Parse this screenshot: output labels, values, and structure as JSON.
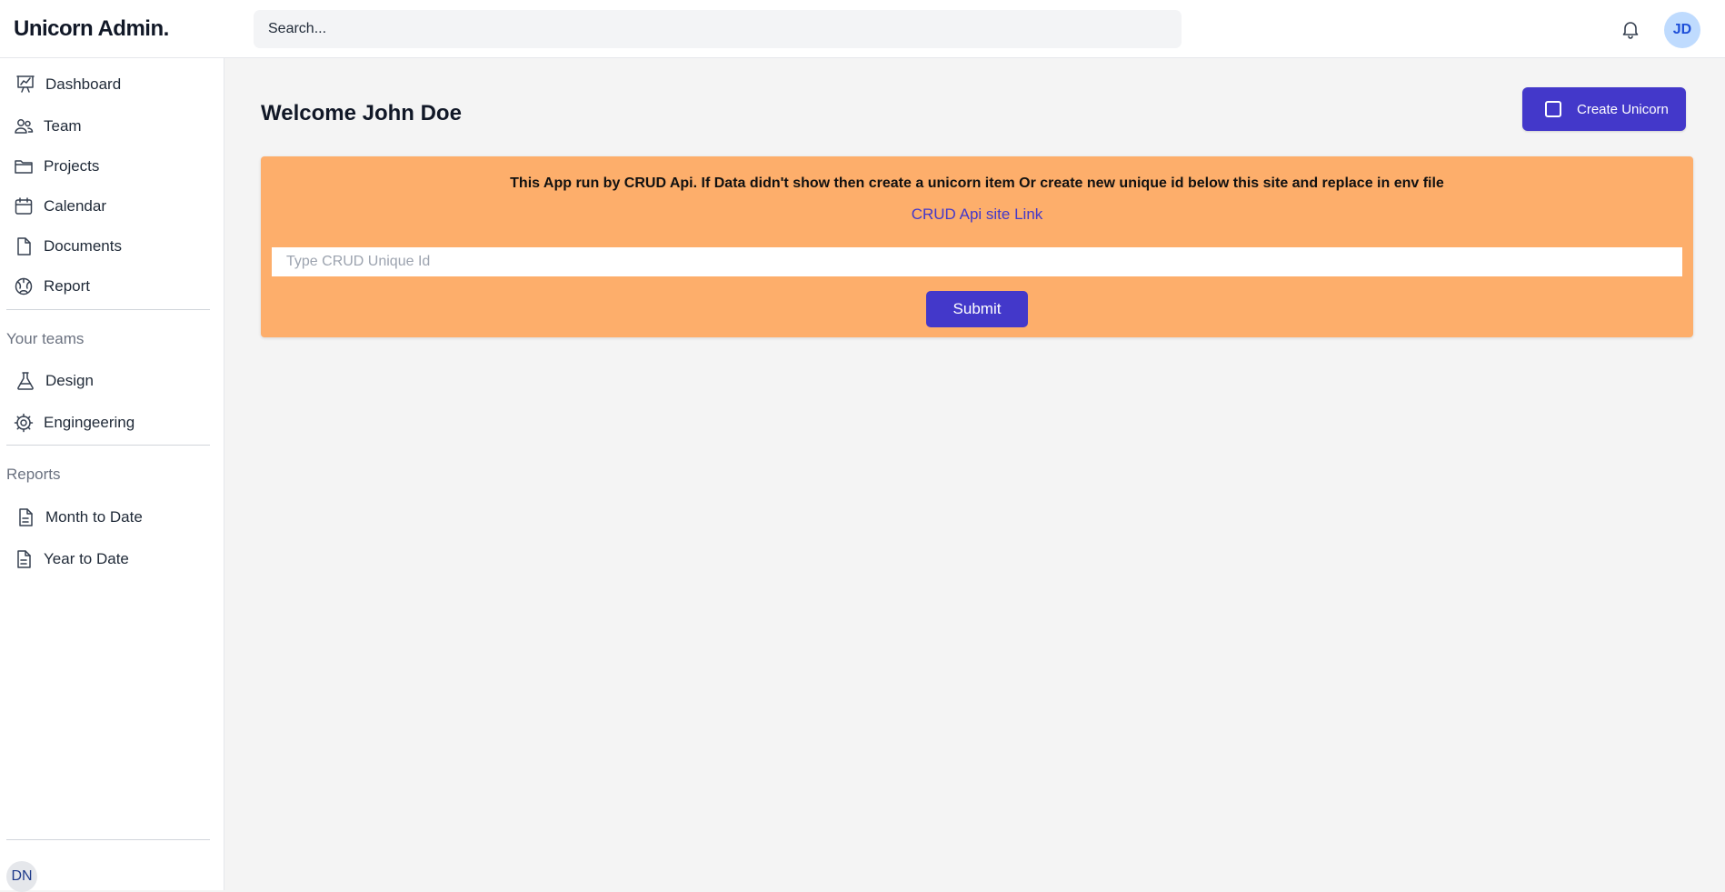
{
  "app": {
    "brand": "Unicorn Admin."
  },
  "header": {
    "search_placeholder": "Search...",
    "bell_icon": "bell-icon",
    "user_initials": "JD"
  },
  "sidebar": {
    "main_items": [
      {
        "label": "Dashboard",
        "icon": "chart-presentation-icon"
      },
      {
        "label": "Team",
        "icon": "users-icon"
      },
      {
        "label": "Projects",
        "icon": "folder-icon"
      },
      {
        "label": "Calendar",
        "icon": "calendar-icon"
      },
      {
        "label": "Documents",
        "icon": "document-icon"
      },
      {
        "label": "Report",
        "icon": "globe-icon"
      }
    ],
    "teams_title": "Your teams",
    "teams": [
      {
        "label": "Design",
        "icon": "beaker-icon"
      },
      {
        "label": "Engingeering",
        "icon": "cog-icon"
      }
    ],
    "reports_title": "Reports",
    "reports": [
      {
        "label": "Month to Date",
        "icon": "document-text-icon"
      },
      {
        "label": "Year to Date",
        "icon": "document-text-icon"
      }
    ],
    "footer_initials": "DN"
  },
  "main": {
    "welcome": "Welcome John Doe",
    "create_button": "Create Unicorn",
    "notice": {
      "message": "This App run by CRUD Api. If Data didn't show then create a unicorn item Or create new unique id below this site and replace in env file",
      "link_text": "CRUD Api site Link",
      "input_placeholder": "Type CRUD Unique Id",
      "submit_label": "Submit"
    }
  },
  "colors": {
    "accent": "#4338ca",
    "notice_bg": "#fdae6b",
    "avatar_bg": "#bfdbfe"
  }
}
